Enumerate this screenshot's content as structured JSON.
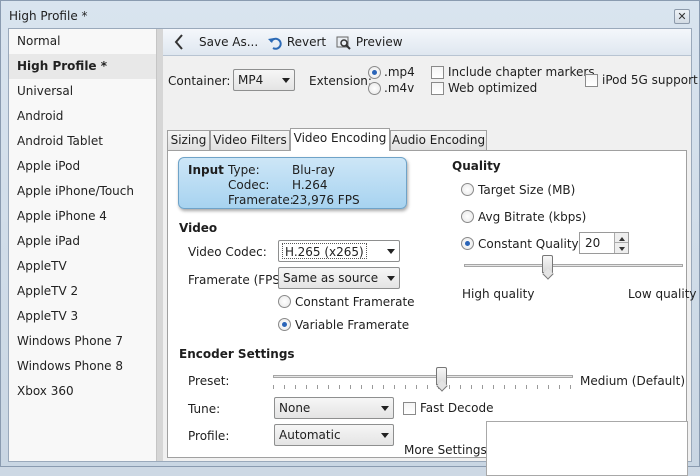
{
  "window": {
    "title": "High Profile *",
    "close_label": "✕"
  },
  "sidebar": {
    "items": [
      {
        "label": "Normal"
      },
      {
        "label": "High Profile *",
        "selected": true
      },
      {
        "label": "Universal"
      },
      {
        "label": "Android"
      },
      {
        "label": "Android Tablet"
      },
      {
        "label": "Apple iPod"
      },
      {
        "label": "Apple iPhone/Touch"
      },
      {
        "label": "Apple iPhone 4"
      },
      {
        "label": "Apple iPad"
      },
      {
        "label": "AppleTV"
      },
      {
        "label": "AppleTV 2"
      },
      {
        "label": "AppleTV 3"
      },
      {
        "label": "Windows Phone 7"
      },
      {
        "label": "Windows Phone 8"
      },
      {
        "label": "Xbox 360"
      }
    ]
  },
  "toolbar": {
    "back_icon": "chevron-left-icon",
    "save_as": "Save As...",
    "revert": "Revert",
    "preview": "Preview"
  },
  "output": {
    "container_label": "Container:",
    "container_value": "MP4",
    "extension_label": "Extension:",
    "ext_mp4": ".mp4",
    "ext_m4v": ".m4v",
    "chapter_markers": "Include chapter markers",
    "web_optimized": "Web optimized",
    "ipod_support": "iPod 5G support"
  },
  "tabs": [
    "Sizing",
    "Video Filters",
    "Video Encoding",
    "Audio Encoding"
  ],
  "input": {
    "heading": "Input",
    "type_label": "Type:",
    "type_value": "Blu-ray",
    "codec_label": "Codec:",
    "codec_value": "H.264",
    "framerate_label": "Framerate:",
    "framerate_value": "23,976 FPS"
  },
  "video": {
    "heading": "Video",
    "codec_label": "Video Codec:",
    "codec_value": "H.265 (x265)",
    "framerate_label": "Framerate (FPS):",
    "framerate_value": "Same as source",
    "constant_framerate": "Constant Framerate",
    "variable_framerate": "Variable Framerate"
  },
  "quality": {
    "heading": "Quality",
    "target_size": "Target Size (MB)",
    "avg_bitrate": "Avg Bitrate (kbps)",
    "constant_quality": "Constant Quality",
    "cq_value": "20",
    "high_quality": "High quality",
    "low_quality": "Low quality",
    "slider_level": 0.38
  },
  "encoder": {
    "heading": "Encoder Settings",
    "preset_label": "Preset:",
    "preset_value": "Medium (Default)",
    "preset_level": 0.56,
    "tune_label": "Tune:",
    "tune_value": "None",
    "fast_decode": "Fast Decode",
    "profile_label": "Profile:",
    "profile_value": "Automatic",
    "more_settings_label": "More Settings:"
  }
}
